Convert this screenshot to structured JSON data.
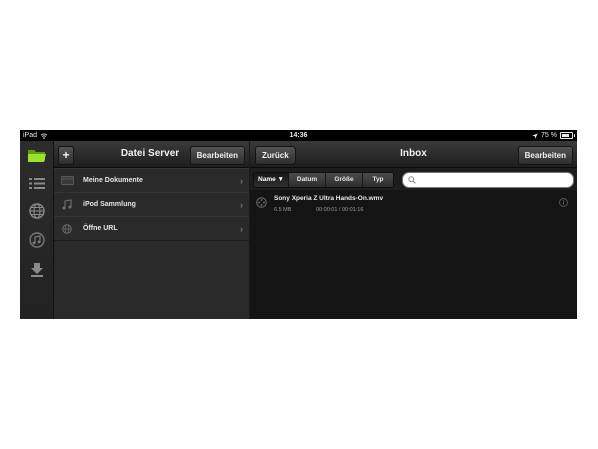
{
  "status_bar": {
    "device": "iPad",
    "time": "14:36",
    "battery": "75 %"
  },
  "sidebar_tabs": [
    {
      "icon": "folder-icon",
      "active": true
    },
    {
      "icon": "list-icon"
    },
    {
      "icon": "globe-icon"
    },
    {
      "icon": "music-icon"
    },
    {
      "icon": "download-icon"
    }
  ],
  "file_server": {
    "title": "Datei Server",
    "add_label": "+",
    "edit_label": "Bearbeiten",
    "items": [
      {
        "label": "Meine Dokumente",
        "icon": "documents-icon"
      },
      {
        "label": "iPod Sammlung",
        "icon": "music-note-icon"
      },
      {
        "label": "Öffne URL",
        "icon": "globe-small-icon"
      }
    ]
  },
  "inbox": {
    "title": "Inbox",
    "back_label": "Zurück",
    "edit_label": "Bearbeiten",
    "sort_tabs": [
      "Name ▼",
      "Datum",
      "Größe",
      "Typ"
    ],
    "active_sort": 0,
    "search_placeholder": "",
    "files": [
      {
        "name": "Sony Xperia Z Ultra Hands-On.wmv",
        "size": "6.5 MB",
        "duration": "00:00:01 / 00:01:16"
      }
    ]
  },
  "colors": {
    "accent_green": "#8fd12a",
    "background": "#1b1b1b"
  }
}
